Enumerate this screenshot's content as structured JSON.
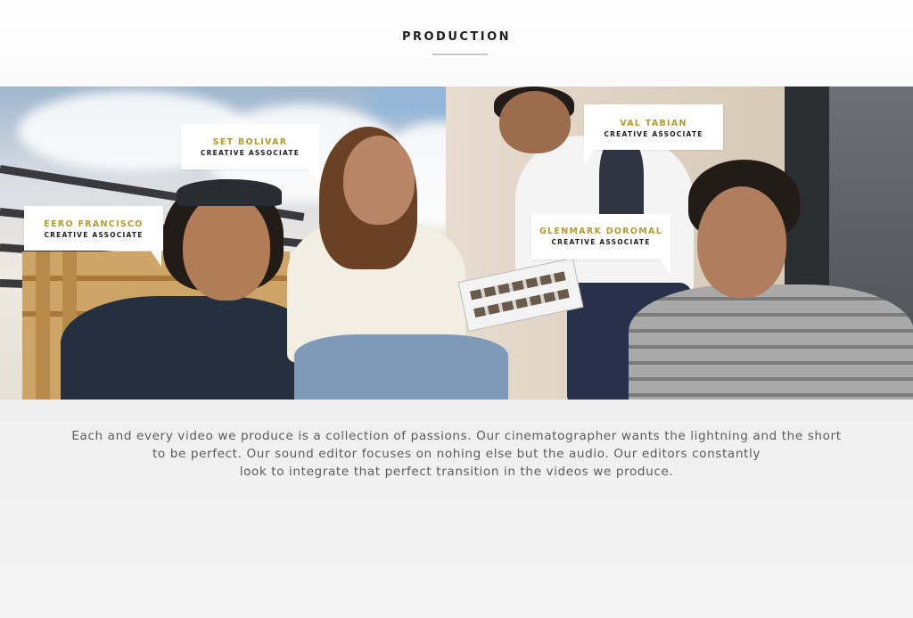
{
  "section": {
    "title": "PRODUCTION"
  },
  "team": [
    {
      "name": "EERO FRANCISCO",
      "role": "CREATIVE ASSOCIATE"
    },
    {
      "name": "SET BOLIVAR",
      "role": "CREATIVE ASSOCIATE"
    },
    {
      "name": "VAL TABIAN",
      "role": "CREATIVE ASSOCIATE"
    },
    {
      "name": "GLENMARK DOROMAL",
      "role": "CREATIVE ASSOCIATE"
    }
  ],
  "description": {
    "lines": [
      "Each and every video we produce is a collection of passions. Our cinematographer wants the lightning and the short",
      "to be perfect. Our sound editor focuses on nohing else but the audio. Our editors constantly",
      "look to integrate that perfect transition in the videos we produce."
    ]
  },
  "colors": {
    "name_accent": "#b09a34",
    "title_text": "#1e1e1e",
    "body_text": "#5b5b5b",
    "panel_bg": "#efefef"
  }
}
